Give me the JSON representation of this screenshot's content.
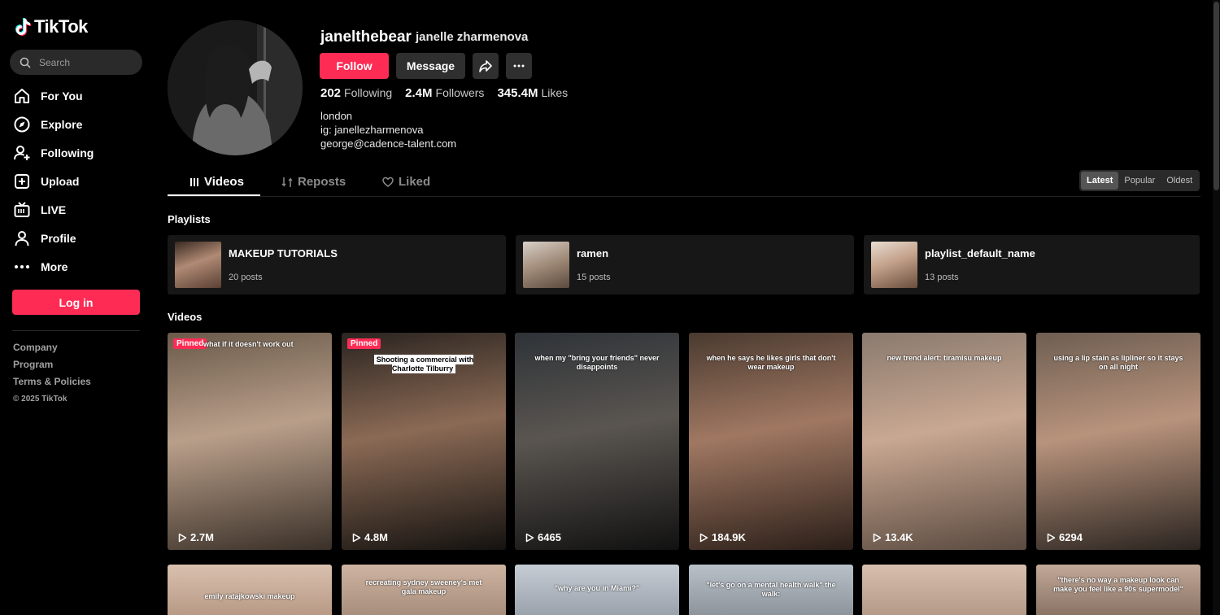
{
  "app": {
    "logo": "TikTok"
  },
  "search": {
    "placeholder": "Search"
  },
  "nav": [
    {
      "label": "For You",
      "icon": "home-icon"
    },
    {
      "label": "Explore",
      "icon": "compass-icon"
    },
    {
      "label": "Following",
      "icon": "following-icon"
    },
    {
      "label": "Upload",
      "icon": "upload-icon"
    },
    {
      "label": "LIVE",
      "icon": "live-icon"
    },
    {
      "label": "Profile",
      "icon": "profile-icon"
    },
    {
      "label": "More",
      "icon": "more-icon"
    }
  ],
  "login_label": "Log in",
  "footer": {
    "company": "Company",
    "program": "Program",
    "terms": "Terms & Policies",
    "copyright": "© 2025 TikTok"
  },
  "profile": {
    "username": "janelthebear",
    "nickname": "janelle zharmenova",
    "follow_label": "Follow",
    "message_label": "Message",
    "stats": [
      {
        "value": "202",
        "label": "Following"
      },
      {
        "value": "2.4M",
        "label": "Followers"
      },
      {
        "value": "345.4M",
        "label": "Likes"
      }
    ],
    "bio": [
      "london",
      "ig: janellezharmenova",
      "george@cadence-talent.com"
    ]
  },
  "tabs": [
    {
      "label": "Videos",
      "active": true
    },
    {
      "label": "Reposts",
      "active": false
    },
    {
      "label": "Liked",
      "active": false
    }
  ],
  "sort": [
    {
      "label": "Latest",
      "active": true
    },
    {
      "label": "Popular",
      "active": false
    },
    {
      "label": "Oldest",
      "active": false
    }
  ],
  "playlists_heading": "Playlists",
  "playlists": [
    {
      "name": "MAKEUP TUTORIALS",
      "count": "20 posts"
    },
    {
      "name": "ramen",
      "count": "15 posts"
    },
    {
      "name": "playlist_default_name",
      "count": "13 posts"
    }
  ],
  "videos_heading": "Videos",
  "videos_row1": [
    {
      "views": "2.7M",
      "pinned": "Pinned",
      "caption": "what if it doesn't work out",
      "colors": [
        "#6a5a4a",
        "#b99f8a",
        "#3a3028"
      ]
    },
    {
      "views": "4.8M",
      "pinned": "Pinned",
      "caption": "Shooting a commercial with Charlotte Tilburry",
      "colors": [
        "#2a2420",
        "#8b6a55",
        "#141210"
      ]
    },
    {
      "views": "6465",
      "pinned": "",
      "caption": "when my \"bring your friends\" never disappoints",
      "colors": [
        "#2e3338",
        "#5a5550",
        "#111"
      ]
    },
    {
      "views": "184.9K",
      "pinned": "",
      "caption": "when he says he likes girls that don't wear makeup",
      "colors": [
        "#4a3a30",
        "#a07862",
        "#2a1e18"
      ]
    },
    {
      "views": "13.4K",
      "pinned": "",
      "caption": "new trend alert: tiramisu makeup",
      "colors": [
        "#8a7a6e",
        "#c9a892",
        "#5a4a40"
      ]
    },
    {
      "views": "6294",
      "pinned": "",
      "caption": "using a lip stain as lipliner so it stays on all night",
      "colors": [
        "#6e5e52",
        "#b8937c",
        "#2a2420"
      ]
    }
  ],
  "videos_row2": [
    {
      "caption": "emily ratajkowski makeup",
      "colors": [
        "#b89a86",
        "#d9c0ae"
      ]
    },
    {
      "caption": "recreating sydney sweeney's met gala makeup",
      "colors": [
        "#a88e7c",
        "#cdb3a0"
      ]
    },
    {
      "caption": "\"why are you in Miami?\"",
      "colors": [
        "#9aa2ac",
        "#c6ccd4"
      ]
    },
    {
      "caption": "\"let's go on a mental health walk\" the walk:",
      "colors": [
        "#8d949c",
        "#b8c0c8"
      ]
    },
    {
      "caption": "",
      "colors": [
        "#b59a88",
        "#d8bfae"
      ]
    },
    {
      "caption": "\"there's no way a makeup look can make you feel like a 90s supermodel\"",
      "colors": [
        "#8a7466",
        "#c2a898"
      ]
    }
  ]
}
